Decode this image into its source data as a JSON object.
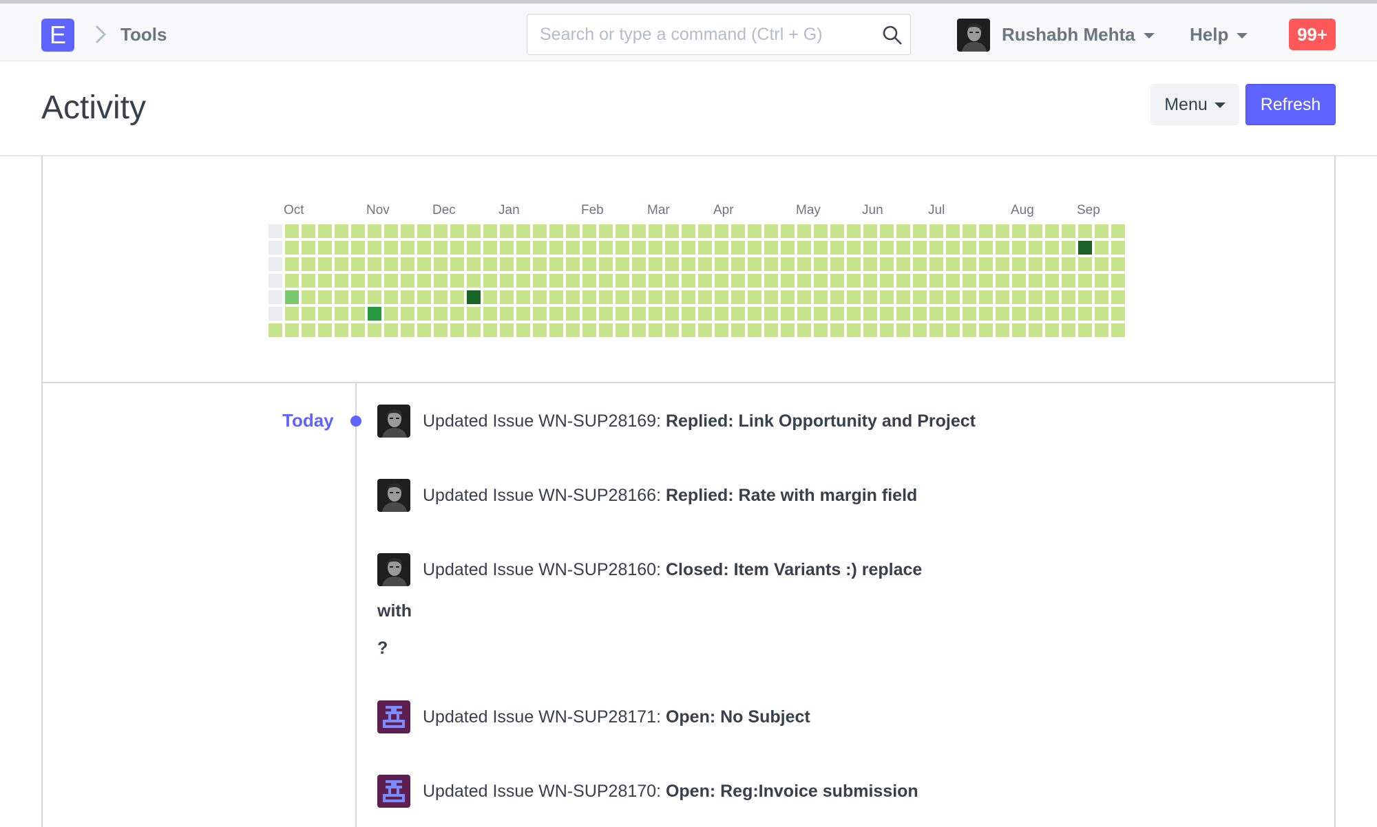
{
  "navbar": {
    "logo_letter": "E",
    "breadcrumb": "Tools",
    "search_placeholder": "Search or type a command (Ctrl + G)",
    "user_name": "Rushabh Mehta",
    "help_label": "Help",
    "notification_count": "99+"
  },
  "page": {
    "title": "Activity",
    "menu_label": "Menu",
    "refresh_label": "Refresh"
  },
  "heatmap": {
    "months": [
      "Oct",
      "Nov",
      "Dec",
      "Jan",
      "Feb",
      "Mar",
      "Apr",
      "May",
      "Jun",
      "Jul",
      "Aug",
      "Sep"
    ],
    "month_start_weeks": [
      1,
      6,
      10,
      14,
      19,
      23,
      27,
      32,
      36,
      40,
      45,
      49
    ],
    "weeks": 52,
    "colors": {
      "empty": "#ebedf0",
      "level1": "#c6e48b",
      "level2": "#7bc96f",
      "level3": "#239a3b",
      "level4": "#196127"
    },
    "highlights": [
      {
        "week": 1,
        "day": 4,
        "level": 2
      },
      {
        "week": 6,
        "day": 5,
        "level": 3
      },
      {
        "week": 12,
        "day": 4,
        "level": 4
      },
      {
        "week": 49,
        "day": 1,
        "level": 4
      }
    ],
    "empty_cells": [
      {
        "week": 0,
        "day": 0
      },
      {
        "week": 0,
        "day": 1
      },
      {
        "week": 0,
        "day": 2
      },
      {
        "week": 0,
        "day": 3
      },
      {
        "week": 0,
        "day": 4
      },
      {
        "week": 0,
        "day": 5
      }
    ]
  },
  "timeline": {
    "date_label": "Today",
    "items": [
      {
        "prefix": "Updated Issue WN-SUP28169: ",
        "subject": "Replied: Link Opportunity and Project",
        "avatar": "photo"
      },
      {
        "prefix": "Updated Issue WN-SUP28166: ",
        "subject": "Replied: Rate with margin field",
        "avatar": "photo"
      },
      {
        "prefix": "Updated Issue WN-SUP28160: ",
        "subject": "Closed: Item Variants :) replace",
        "avatar": "photo"
      },
      {
        "prefix": "Updated Issue WN-SUP28171: ",
        "subject": "Open: No Subject",
        "avatar": "identicon"
      },
      {
        "prefix": "Updated Issue WN-SUP28170: ",
        "subject": "Open: Reg:Invoice submission",
        "avatar": "identicon"
      }
    ],
    "continuation": [
      "with",
      "?"
    ]
  }
}
